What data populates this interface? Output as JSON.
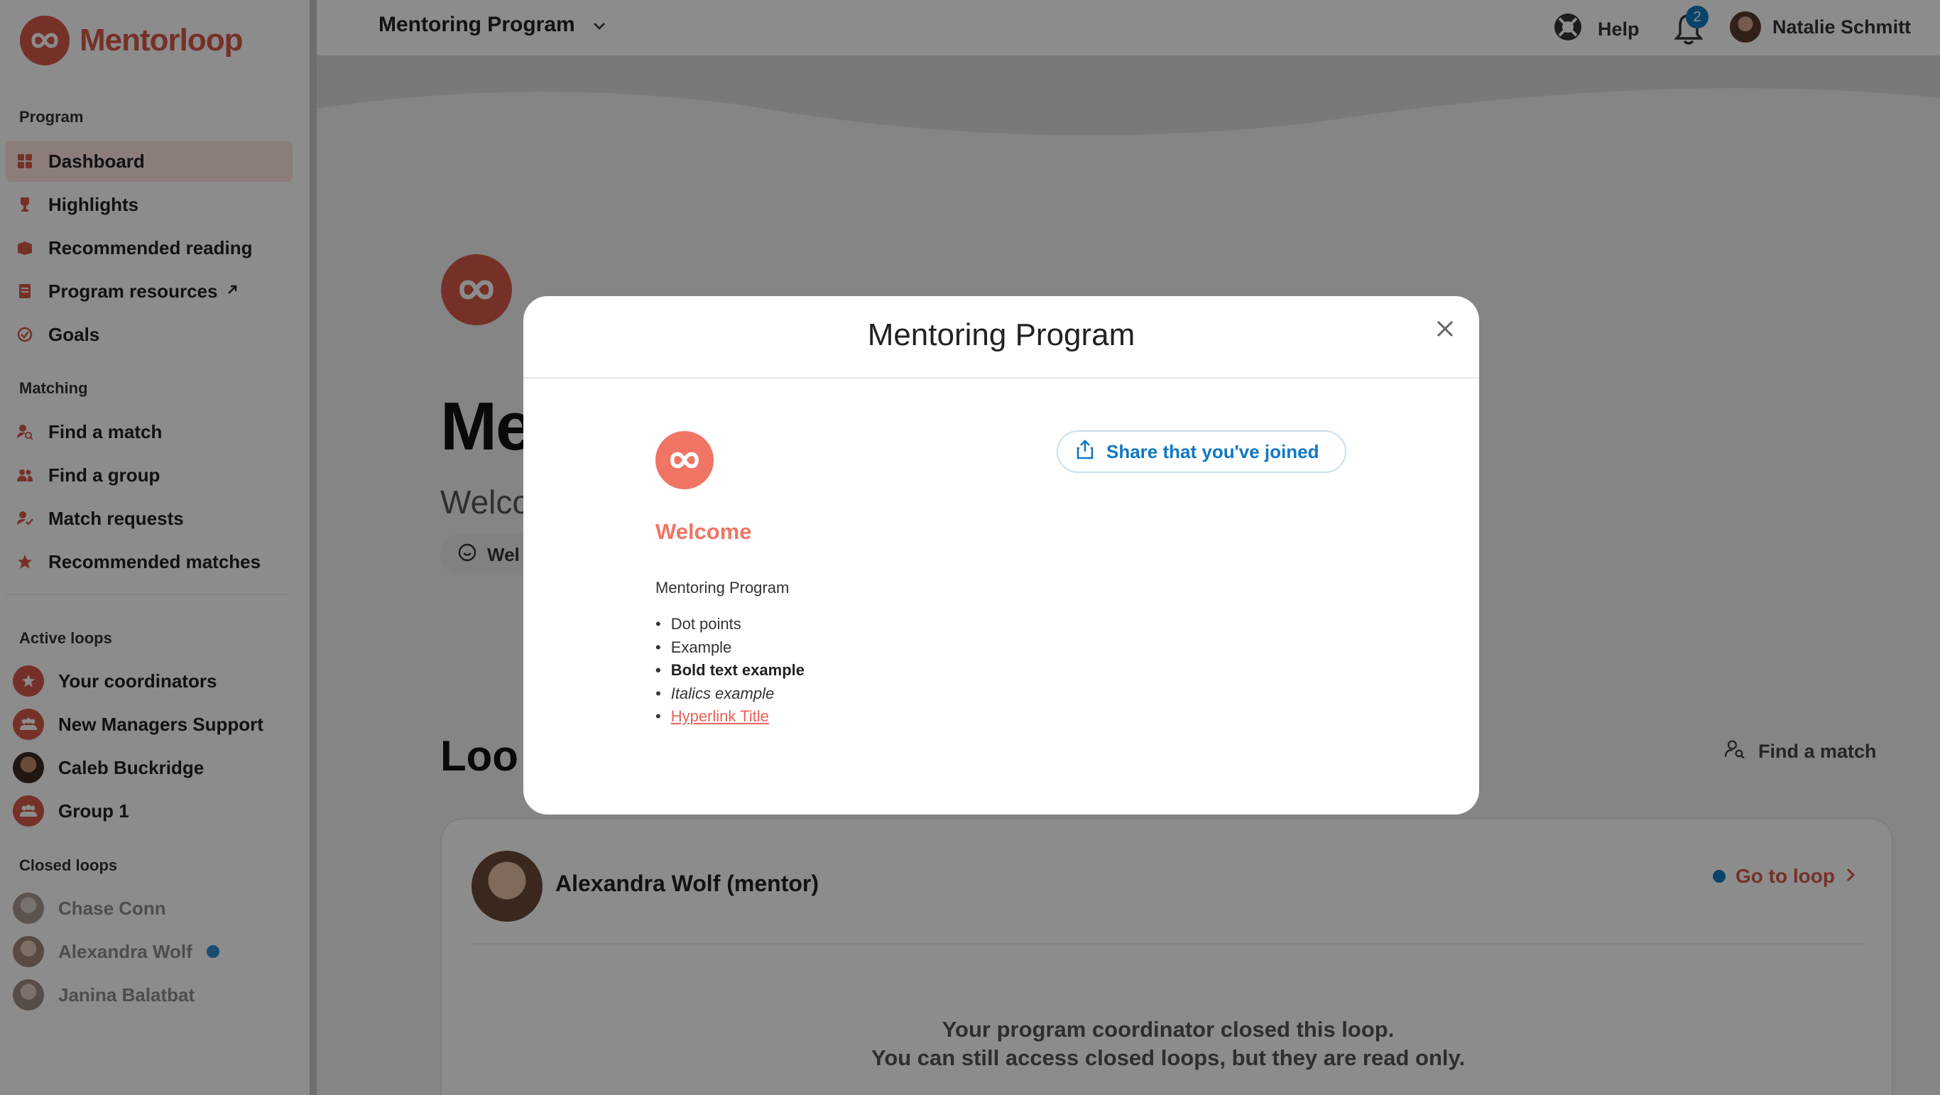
{
  "brand": {
    "name": "Mentorloop",
    "color": "#d65a4a"
  },
  "sidebar": {
    "sections": {
      "program": "Program",
      "matching": "Matching",
      "active_loops": "Active loops",
      "closed_loops": "Closed loops"
    },
    "program_items": [
      {
        "label": "Dashboard",
        "icon": "dashboard-icon",
        "active": true
      },
      {
        "label": "Highlights",
        "icon": "trophy-icon"
      },
      {
        "label": "Recommended reading",
        "icon": "book-icon"
      },
      {
        "label": "Program resources",
        "icon": "document-icon",
        "external": true
      },
      {
        "label": "Goals",
        "icon": "goal-check-icon"
      }
    ],
    "matching_items": [
      {
        "label": "Find a match",
        "icon": "person-search-icon"
      },
      {
        "label": "Find a group",
        "icon": "group-icon"
      },
      {
        "label": "Match requests",
        "icon": "person-check-icon"
      },
      {
        "label": "Recommended matches",
        "icon": "star-icon"
      }
    ],
    "active_loops": [
      {
        "label": "Your coordinators",
        "icon": "star-icon"
      },
      {
        "label": "New Managers Support",
        "icon": "group-icon"
      },
      {
        "label": "Caleb Buckridge",
        "icon": "avatar"
      },
      {
        "label": "Group 1",
        "icon": "group-icon"
      }
    ],
    "closed_loops": [
      {
        "label": "Chase Conn",
        "icon": "avatar"
      },
      {
        "label": "Alexandra Wolf",
        "icon": "avatar",
        "unread": true
      },
      {
        "label": "Janina Balatbat",
        "icon": "avatar"
      }
    ]
  },
  "topbar": {
    "program_name": "Mentoring Program",
    "help_label": "Help",
    "notification_count": "2",
    "user_name": "Natalie Schmitt"
  },
  "main": {
    "title_partial": "Me",
    "welcome_partial": "Welco",
    "pill_partial": "Wel",
    "loops_title_partial": "Loo",
    "find_match_label": "Find a match",
    "loop_card": {
      "name": "Alexandra Wolf (mentor)",
      "go_to_loop_label": "Go to loop",
      "closed_message_line1": "Your program coordinator closed this loop.",
      "closed_message_line2": "You can still access closed loops, but they are read only."
    }
  },
  "modal": {
    "title": "Mentoring Program",
    "heading": "Welcome",
    "description": "Mentoring Program",
    "bullets": [
      "Dot points",
      "Example",
      "Bold text example",
      "Italics example",
      "Hyperlink Title"
    ],
    "share_button_label": "Share that you've joined",
    "colors": {
      "accent": "#f07565",
      "link": "#e8615a",
      "share": "#1178c4"
    }
  }
}
